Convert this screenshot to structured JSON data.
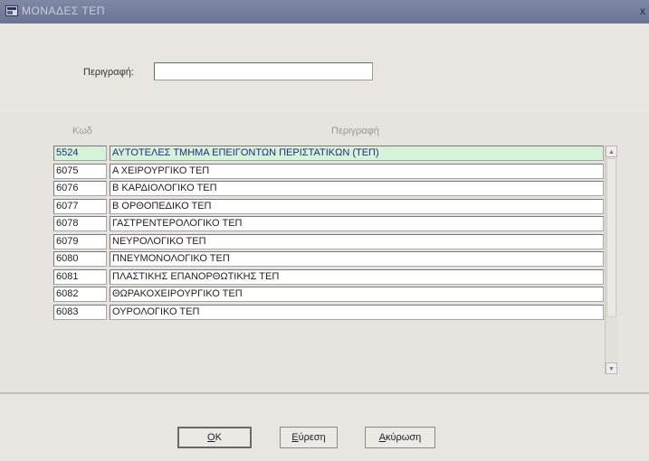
{
  "window": {
    "title": "ΜΟΝΑΔΕΣ ΤΕΠ",
    "close_label": "x"
  },
  "search": {
    "label": "Περιγραφή:",
    "value": "",
    "placeholder": ""
  },
  "list": {
    "columns": {
      "code": "Κωδ",
      "description": "Περιγραφή"
    },
    "rows": [
      {
        "code": "5524",
        "description": "ΑΥΤΟΤΕΛΕΣ ΤΜΗΜΑ ΕΠΕΙΓΟΝΤΩΝ ΠΕΡΙΣΤΑΤΙΚΩΝ (ΤΕΠ)",
        "selected": true
      },
      {
        "code": "6075",
        "description": "Α ΧΕΙΡΟΥΡΓΙΚΟ ΤΕΠ"
      },
      {
        "code": "6076",
        "description": "Β ΚΑΡΔΙΟΛΟΓΙΚΟ ΤΕΠ"
      },
      {
        "code": "6077",
        "description": "Β ΟΡΘΟΠΕΔΙΚΟ ΤΕΠ"
      },
      {
        "code": "6078",
        "description": "ΓΑΣΤΡΕΝΤΕΡΟΛΟΓΙΚΟ ΤΕΠ"
      },
      {
        "code": "6079",
        "description": "ΝΕΥΡΟΛΟΓΙΚΟ ΤΕΠ"
      },
      {
        "code": "6080",
        "description": "ΠΝΕΥΜΟΝΟΛΟΓΙΚΟ ΤΕΠ"
      },
      {
        "code": "6081",
        "description": "ΠΛΑΣΤΙΚΗΣ ΕΠΑΝΟΡΘΩΤΙΚΗΣ ΤΕΠ"
      },
      {
        "code": "6082",
        "description": "ΘΩΡΑΚΟΧΕΙΡΟΥΡΓΙΚΟ ΤΕΠ"
      },
      {
        "code": "6083",
        "description": "ΟΥΡΟΛΟΓΙΚΟ ΤΕΠ"
      }
    ]
  },
  "buttons": {
    "ok": {
      "accel": "O",
      "rest": "K"
    },
    "find": {
      "accel": "Ε",
      "rest": "ύρεση"
    },
    "cancel": {
      "accel": "Α",
      "rest": "κύρωση"
    }
  },
  "colors": {
    "titlebar": "#6a7493",
    "selected_row": "#d6f2d8",
    "selected_text": "#1c2f80"
  }
}
